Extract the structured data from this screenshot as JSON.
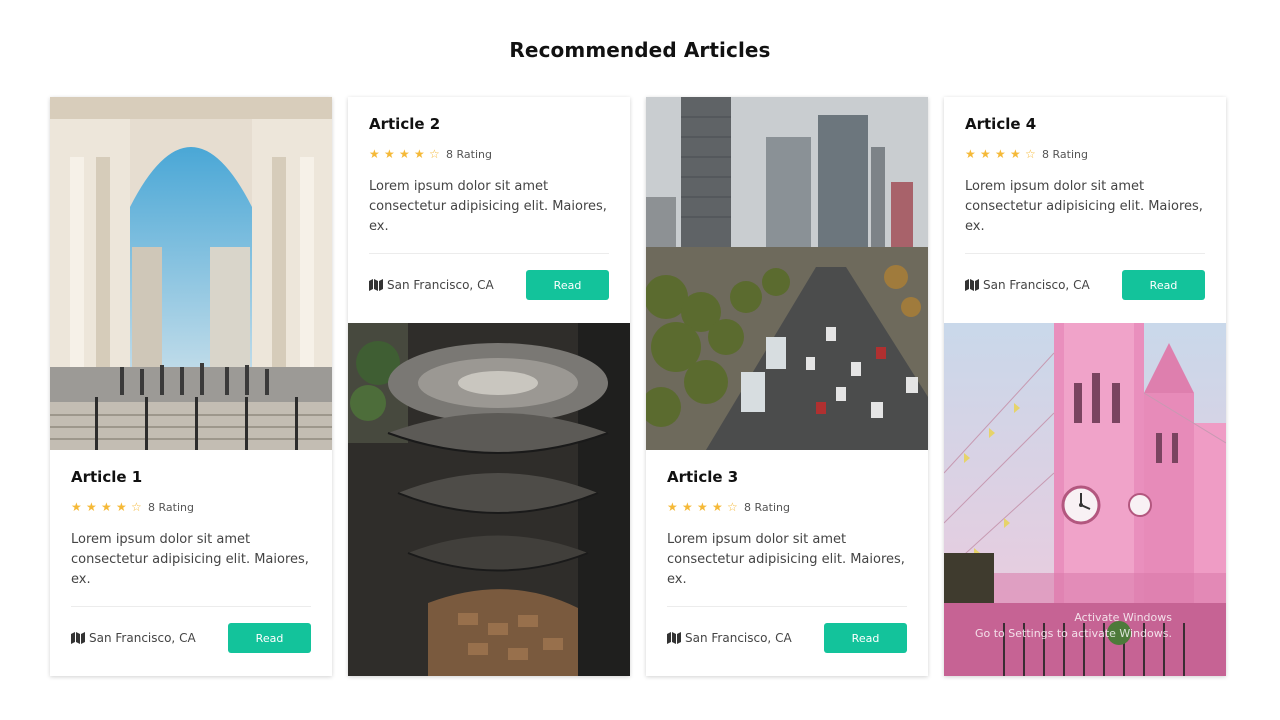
{
  "page": {
    "title": "Recommended Articles"
  },
  "articles": [
    {
      "title": "Article 1",
      "stars_filled": 4,
      "stars_total": 5,
      "rating_label": "8 Rating",
      "description": "Lorem ipsum dolor sit amet consectetur adipisicing elit. Maiores, ex.",
      "location": "San Francisco, CA",
      "button_label": "Read",
      "image": "arch-street-photo",
      "image_position": "top"
    },
    {
      "title": "Article 2",
      "stars_filled": 4,
      "stars_total": 5,
      "rating_label": "8 Rating",
      "description": "Lorem ipsum dolor sit amet consectetur adipisicing elit. Maiores, ex.",
      "location": "San Francisco, CA",
      "button_label": "Read",
      "image": "spiral-staircase-photo",
      "image_position": "bottom"
    },
    {
      "title": "Article 3",
      "stars_filled": 4,
      "stars_total": 5,
      "rating_label": "8 Rating",
      "description": "Lorem ipsum dolor sit amet consectetur adipisicing elit. Maiores, ex.",
      "location": "San Francisco, CA",
      "button_label": "Read",
      "image": "city-skyline-photo",
      "image_position": "top"
    },
    {
      "title": "Article 4",
      "stars_filled": 4,
      "stars_total": 5,
      "rating_label": "8 Rating",
      "description": "Lorem ipsum dolor sit amet consectetur adipisicing elit. Maiores, ex.",
      "location": "San Francisco, CA",
      "button_label": "Read",
      "image": "pink-church-photo",
      "image_position": "bottom"
    }
  ],
  "overlay": {
    "line1": "Activate Windows",
    "line2": "Go to Settings to activate Windows."
  },
  "colors": {
    "accent": "#13c39b",
    "star": "#f5b938",
    "text": "#444444"
  }
}
